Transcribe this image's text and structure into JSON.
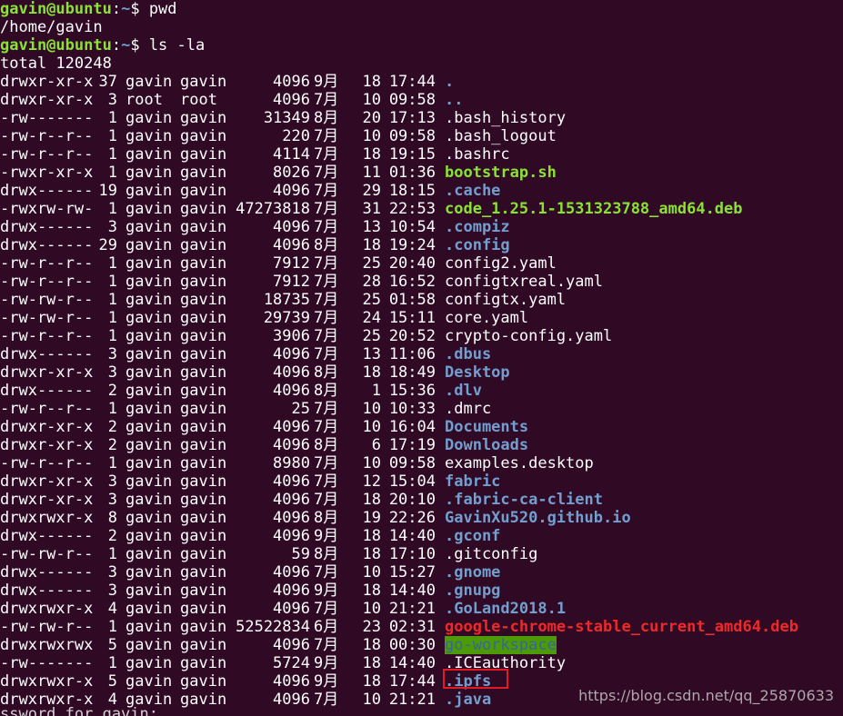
{
  "prompt": {
    "user": "gavin@ubuntu",
    "path": "~",
    "symbol": "$"
  },
  "commands": [
    {
      "cmd": " pwd",
      "output": "/home/gavin"
    },
    {
      "cmd": " ls -la",
      "output": "total 120248"
    }
  ],
  "entries": [
    {
      "perm": "drwxr-xr-x",
      "links": "37",
      "owner": "gavin",
      "group": "gavin",
      "size": "4096",
      "month": "9月",
      "day": "18",
      "time": "17:44",
      "name": ".",
      "type": "dir"
    },
    {
      "perm": "drwxr-xr-x",
      "links": "3",
      "owner": "root",
      "group": "root",
      "size": "4096",
      "month": "7月",
      "day": "10",
      "time": "09:58",
      "name": "..",
      "type": "dir"
    },
    {
      "perm": "-rw-------",
      "links": "1",
      "owner": "gavin",
      "group": "gavin",
      "size": "31349",
      "month": "8月",
      "day": "20",
      "time": "17:13",
      "name": ".bash_history",
      "type": "file"
    },
    {
      "perm": "-rw-r--r--",
      "links": "1",
      "owner": "gavin",
      "group": "gavin",
      "size": "220",
      "month": "7月",
      "day": "10",
      "time": "09:58",
      "name": ".bash_logout",
      "type": "file"
    },
    {
      "perm": "-rw-r--r--",
      "links": "1",
      "owner": "gavin",
      "group": "gavin",
      "size": "4114",
      "month": "7月",
      "day": "18",
      "time": "19:15",
      "name": ".bashrc",
      "type": "file"
    },
    {
      "perm": "-rwxr-xr-x",
      "links": "1",
      "owner": "gavin",
      "group": "gavin",
      "size": "8026",
      "month": "7月",
      "day": "11",
      "time": "01:36",
      "name": "bootstrap.sh",
      "type": "exe"
    },
    {
      "perm": "drwx------",
      "links": "19",
      "owner": "gavin",
      "group": "gavin",
      "size": "4096",
      "month": "7月",
      "day": "29",
      "time": "18:15",
      "name": ".cache",
      "type": "dir"
    },
    {
      "perm": "-rwxrw-rw-",
      "links": "1",
      "owner": "gavin",
      "group": "gavin",
      "size": "47273818",
      "month": "7月",
      "day": "31",
      "time": "22:53",
      "name": "code_1.25.1-1531323788_amd64.deb",
      "type": "exe"
    },
    {
      "perm": "drwx------",
      "links": "3",
      "owner": "gavin",
      "group": "gavin",
      "size": "4096",
      "month": "7月",
      "day": "13",
      "time": "10:54",
      "name": ".compiz",
      "type": "dir"
    },
    {
      "perm": "drwx------",
      "links": "29",
      "owner": "gavin",
      "group": "gavin",
      "size": "4096",
      "month": "8月",
      "day": "18",
      "time": "19:24",
      "name": ".config",
      "type": "dir"
    },
    {
      "perm": "-rw-r--r--",
      "links": "1",
      "owner": "gavin",
      "group": "gavin",
      "size": "7912",
      "month": "7月",
      "day": "25",
      "time": "20:40",
      "name": "config2.yaml",
      "type": "file"
    },
    {
      "perm": "-rw-r--r--",
      "links": "1",
      "owner": "gavin",
      "group": "gavin",
      "size": "7912",
      "month": "7月",
      "day": "28",
      "time": "16:52",
      "name": "configtxreal.yaml",
      "type": "file"
    },
    {
      "perm": "-rw-rw-r--",
      "links": "1",
      "owner": "gavin",
      "group": "gavin",
      "size": "18735",
      "month": "7月",
      "day": "25",
      "time": "01:58",
      "name": "configtx.yaml",
      "type": "file"
    },
    {
      "perm": "-rw-rw-r--",
      "links": "1",
      "owner": "gavin",
      "group": "gavin",
      "size": "29739",
      "month": "7月",
      "day": "24",
      "time": "15:11",
      "name": "core.yaml",
      "type": "file"
    },
    {
      "perm": "-rw-r--r--",
      "links": "1",
      "owner": "gavin",
      "group": "gavin",
      "size": "3906",
      "month": "7月",
      "day": "25",
      "time": "20:52",
      "name": "crypto-config.yaml",
      "type": "file"
    },
    {
      "perm": "drwx------",
      "links": "3",
      "owner": "gavin",
      "group": "gavin",
      "size": "4096",
      "month": "7月",
      "day": "13",
      "time": "11:06",
      "name": ".dbus",
      "type": "dir"
    },
    {
      "perm": "drwxr-xr-x",
      "links": "3",
      "owner": "gavin",
      "group": "gavin",
      "size": "4096",
      "month": "8月",
      "day": "18",
      "time": "18:49",
      "name": "Desktop",
      "type": "dir"
    },
    {
      "perm": "drwx------",
      "links": "2",
      "owner": "gavin",
      "group": "gavin",
      "size": "4096",
      "month": "8月",
      "day": "1",
      "time": "15:36",
      "name": ".dlv",
      "type": "dir"
    },
    {
      "perm": "-rw-r--r--",
      "links": "1",
      "owner": "gavin",
      "group": "gavin",
      "size": "25",
      "month": "7月",
      "day": "10",
      "time": "10:33",
      "name": ".dmrc",
      "type": "file"
    },
    {
      "perm": "drwxr-xr-x",
      "links": "2",
      "owner": "gavin",
      "group": "gavin",
      "size": "4096",
      "month": "7月",
      "day": "10",
      "time": "16:04",
      "name": "Documents",
      "type": "dir"
    },
    {
      "perm": "drwxr-xr-x",
      "links": "2",
      "owner": "gavin",
      "group": "gavin",
      "size": "4096",
      "month": "8月",
      "day": "6",
      "time": "17:19",
      "name": "Downloads",
      "type": "dir"
    },
    {
      "perm": "-rw-r--r--",
      "links": "1",
      "owner": "gavin",
      "group": "gavin",
      "size": "8980",
      "month": "7月",
      "day": "10",
      "time": "09:58",
      "name": "examples.desktop",
      "type": "file"
    },
    {
      "perm": "drwxr-xr-x",
      "links": "3",
      "owner": "gavin",
      "group": "gavin",
      "size": "4096",
      "month": "7月",
      "day": "12",
      "time": "15:04",
      "name": "fabric",
      "type": "dir"
    },
    {
      "perm": "drwxr-xr-x",
      "links": "3",
      "owner": "gavin",
      "group": "gavin",
      "size": "4096",
      "month": "7月",
      "day": "18",
      "time": "20:10",
      "name": ".fabric-ca-client",
      "type": "dir"
    },
    {
      "perm": "drwxrwxr-x",
      "links": "8",
      "owner": "gavin",
      "group": "gavin",
      "size": "4096",
      "month": "8月",
      "day": "19",
      "time": "22:26",
      "name": "GavinXu520.github.io",
      "type": "dir"
    },
    {
      "perm": "drwx------",
      "links": "2",
      "owner": "gavin",
      "group": "gavin",
      "size": "4096",
      "month": "9月",
      "day": "18",
      "time": "14:40",
      "name": ".gconf",
      "type": "dir"
    },
    {
      "perm": "-rw-rw-r--",
      "links": "1",
      "owner": "gavin",
      "group": "gavin",
      "size": "59",
      "month": "8月",
      "day": "18",
      "time": "17:10",
      "name": ".gitconfig",
      "type": "file"
    },
    {
      "perm": "drwx------",
      "links": "3",
      "owner": "gavin",
      "group": "gavin",
      "size": "4096",
      "month": "7月",
      "day": "10",
      "time": "15:27",
      "name": ".gnome",
      "type": "dir"
    },
    {
      "perm": "drwx------",
      "links": "3",
      "owner": "gavin",
      "group": "gavin",
      "size": "4096",
      "month": "9月",
      "day": "18",
      "time": "14:40",
      "name": ".gnupg",
      "type": "dir"
    },
    {
      "perm": "drwxrwxr-x",
      "links": "4",
      "owner": "gavin",
      "group": "gavin",
      "size": "4096",
      "month": "7月",
      "day": "10",
      "time": "21:21",
      "name": ".GoLand2018.1",
      "type": "dir"
    },
    {
      "perm": "-rw-rw-r--",
      "links": "1",
      "owner": "gavin",
      "group": "gavin",
      "size": "52522834",
      "month": "6月",
      "day": "23",
      "time": "02:31",
      "name": "google-chrome-stable_current_amd64.deb",
      "type": "arc"
    },
    {
      "perm": "drwxrwxrwx",
      "links": "5",
      "owner": "gavin",
      "group": "gavin",
      "size": "4096",
      "month": "7月",
      "day": "18",
      "time": "00:30",
      "name": "go-workspace",
      "type": "ow"
    },
    {
      "perm": "-rw-------",
      "links": "1",
      "owner": "gavin",
      "group": "gavin",
      "size": "5724",
      "month": "9月",
      "day": "18",
      "time": "14:40",
      "name": ".ICEauthority",
      "type": "file"
    },
    {
      "perm": "drwxrwxr-x",
      "links": "5",
      "owner": "gavin",
      "group": "gavin",
      "size": "4096",
      "month": "9月",
      "day": "18",
      "time": "17:44",
      "name": ".ipfs",
      "type": "dir"
    },
    {
      "perm": "drwxrwxr-x",
      "links": "4",
      "owner": "gavin",
      "group": "gavin",
      "size": "4096",
      "month": "7月",
      "day": "10",
      "time": "21:21",
      "name": ".java",
      "type": "dir"
    }
  ],
  "partial_line": "ssword for gavin:",
  "watermark": "https://blog.csdn.net/qq_25870633"
}
